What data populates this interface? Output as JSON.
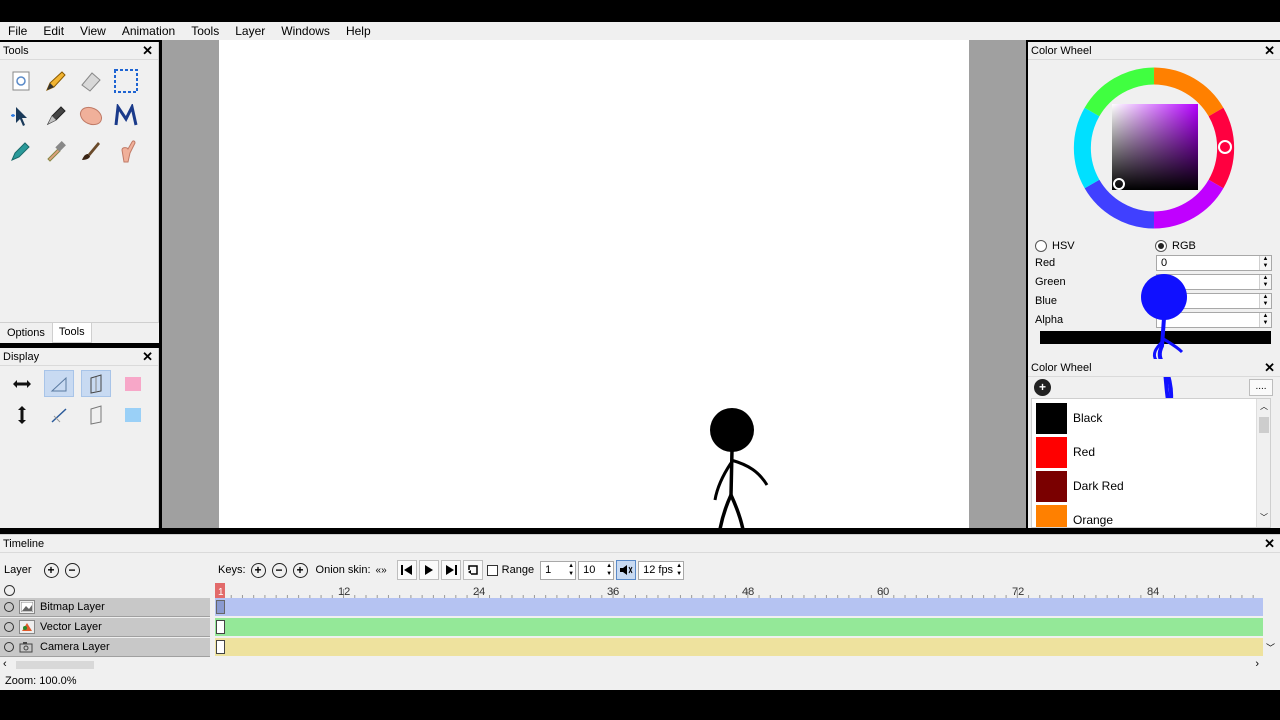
{
  "menu": [
    "File",
    "Edit",
    "View",
    "Animation",
    "Tools",
    "Layer",
    "Windows",
    "Help"
  ],
  "tools_panel": {
    "title": "Tools",
    "tools": [
      "clear-icon",
      "pencil-icon",
      "eraser-icon",
      "select-icon",
      "pointer-icon",
      "pen-icon",
      "smudge-icon",
      "polyline-icon",
      "bucket-icon",
      "eyedropper-icon",
      "brush-icon",
      "hand-icon"
    ]
  },
  "tabs": [
    "Options",
    "Tools"
  ],
  "display_panel": {
    "title": "Display",
    "buttons": [
      "horizontal-flip-icon",
      "thin-lines-icon",
      "outlines-icon",
      "onion-prev-icon",
      "vertical-flip-icon",
      "invisible-lines-icon",
      "onion-blue-icon",
      "onion-next-icon"
    ]
  },
  "color_wheel": {
    "title": "Color Wheel",
    "mode_hsv": "HSV",
    "mode_rgb": "RGB",
    "selected_mode": "RGB",
    "fields": [
      {
        "label": "Red",
        "value": "0"
      },
      {
        "label": "Green",
        "value": ""
      },
      {
        "label": "Blue",
        "value": ""
      },
      {
        "label": "Alpha",
        "value": ""
      }
    ],
    "current_color": "#000000"
  },
  "palette": {
    "title": "Color Wheel",
    "more": "....",
    "colors": [
      {
        "name": "Black",
        "hex": "#000000"
      },
      {
        "name": "Red",
        "hex": "#ff0000"
      },
      {
        "name": "Dark Red",
        "hex": "#7a0000"
      },
      {
        "name": "Orange",
        "hex": "#ff8000"
      }
    ]
  },
  "timeline": {
    "title": "Timeline",
    "layer_label": "Layer",
    "keys_label": "Keys:",
    "onion_label": "Onion skin:",
    "range_label": "Range",
    "range_start": "1",
    "range_end": "10",
    "fps": "12 fps",
    "current_frame": "1",
    "ruler": [
      "12",
      "24",
      "36",
      "48",
      "60",
      "72",
      "84"
    ],
    "layers": [
      {
        "name": "Bitmap Layer",
        "color": "#b5c3f2"
      },
      {
        "name": "Vector Layer",
        "color": "#94e898"
      },
      {
        "name": "Camera Layer",
        "color": "#eee29e"
      }
    ]
  },
  "status": {
    "zoom": "Zoom: 100.0%"
  }
}
